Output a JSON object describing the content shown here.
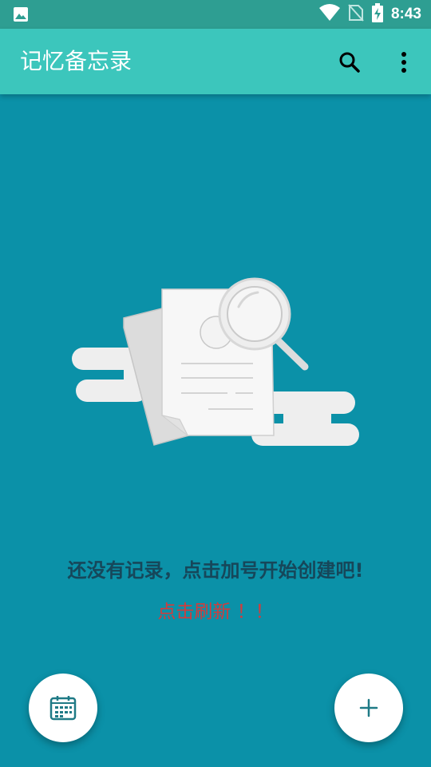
{
  "statusbar": {
    "time": "8:43",
    "icons": [
      "image-icon",
      "wifi-icon",
      "no-sim-icon",
      "battery-charging-icon"
    ]
  },
  "appbar": {
    "title": "记忆备忘录",
    "actions": [
      "search-icon",
      "more-vert-icon"
    ]
  },
  "empty_state": {
    "illustration": "empty-documents-magnifier",
    "message": "还没有记录，点击加号开始创建吧!",
    "refresh": "点击刷新 ！！"
  },
  "fabs": {
    "left": "calendar-icon",
    "right": "plus-icon"
  },
  "colors": {
    "background": "#0b91a8",
    "statusbar": "#2e9e92",
    "appbar": "#3cc6bc",
    "message": "#16475a",
    "refresh": "#d23c3c",
    "fab_icon": "#1f7a86"
  }
}
